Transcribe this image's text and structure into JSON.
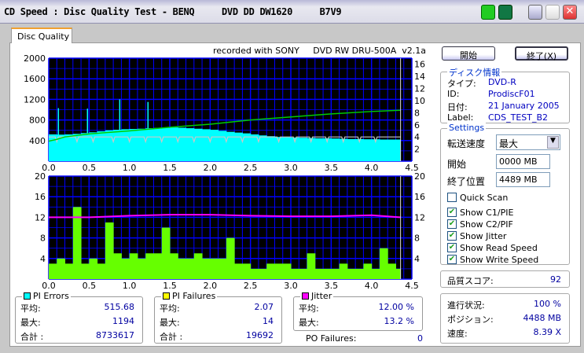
{
  "window": {
    "title": "CD Speed : Disc Quality Test - BENQ     DVD DD DW1620     B7V9"
  },
  "tabs": [
    {
      "label": "Disc Quality"
    }
  ],
  "chart_header": "recorded with SONY     DVD RW DRU-500A  v2.1a",
  "buttons": {
    "start": "開始",
    "stop": "終了(X)"
  },
  "disc_info": {
    "caption": "ディスク情報",
    "rows": [
      {
        "k": "タイプ:",
        "v": "DVD-R"
      },
      {
        "k": "ID:",
        "v": "ProdiscF01"
      },
      {
        "k": "日付:",
        "v": "21 January 2005"
      },
      {
        "k": "Label:",
        "v": "CDS_TEST_B2"
      }
    ]
  },
  "settings": {
    "caption": "Settings",
    "speed_label": "転送速度",
    "speed_value": "最大",
    "start_label": "開始",
    "start_value": "0000 MB",
    "end_label": "終了位置",
    "end_value": "4489 MB",
    "checks": [
      {
        "label": "Quick Scan",
        "checked": false
      },
      {
        "label": "Show C1/PIE",
        "checked": true
      },
      {
        "label": "Show C2/PIF",
        "checked": true
      },
      {
        "label": "Show Jitter",
        "checked": true
      },
      {
        "label": "Show Read Speed",
        "checked": true
      },
      {
        "label": "Show Write Speed",
        "checked": true
      }
    ]
  },
  "quality": {
    "label": "品質スコア:",
    "value": "92"
  },
  "progress": {
    "rows": [
      {
        "k": "進行状況:",
        "v": "100 %"
      },
      {
        "k": "ポジション:",
        "v": "4488 MB"
      },
      {
        "k": "速度:",
        "v": "8.39 X"
      }
    ]
  },
  "stats": {
    "pie": {
      "title": "PI Errors",
      "color": "#00ffff",
      "rows": [
        {
          "k": "平均:",
          "v": "515.68"
        },
        {
          "k": "最大:",
          "v": "1194"
        },
        {
          "k": "合計 :",
          "v": "8733617"
        }
      ]
    },
    "pif": {
      "title": "PI Failures",
      "color": "#ffff00",
      "rows": [
        {
          "k": "平均:",
          "v": "2.07"
        },
        {
          "k": "最大:",
          "v": "14"
        },
        {
          "k": "合計 :",
          "v": "19692"
        }
      ]
    },
    "jitter": {
      "title": "Jitter",
      "color": "#ff00ff",
      "rows": [
        {
          "k": "平均:",
          "v": "12.00 %"
        },
        {
          "k": "最大:",
          "v": "13.2 %"
        }
      ]
    },
    "po": {
      "k": "PO Failures:",
      "v": "0"
    }
  },
  "colors": {
    "plot_bg": "#000000",
    "grid": "#0000ff",
    "pie": "#00ffff",
    "pif": "#66ff00",
    "jitter": "#ff00ff",
    "read": "#00cc00",
    "write": "#c8c8c8"
  },
  "chart_data": [
    {
      "type": "bar",
      "xlim": [
        0,
        4.5
      ],
      "ylim_left": [
        0,
        2000
      ],
      "ylim_right": [
        0,
        17
      ],
      "xticks": [
        "0.0",
        "0.5",
        "1.0",
        "1.5",
        "2.0",
        "2.5",
        "3.0",
        "3.5",
        "4.0",
        "4.5"
      ],
      "yticks_left": [
        "2000",
        "1600",
        "1200",
        "800",
        "400"
      ],
      "yticks_right": [
        "16",
        "14",
        "12",
        "10",
        "8",
        "6",
        "4",
        "2"
      ],
      "pie": {
        "x": [
          0,
          0.1,
          0.2,
          0.3,
          0.4,
          0.5,
          0.6,
          0.7,
          0.8,
          0.9,
          1.0,
          1.1,
          1.2,
          1.3,
          1.4,
          1.5,
          1.6,
          1.7,
          1.8,
          1.9,
          2.0,
          2.1,
          2.2,
          2.3,
          2.4,
          2.5,
          2.6,
          2.7,
          2.8,
          2.9,
          3.0,
          3.1,
          3.2,
          3.3,
          3.4,
          3.5,
          3.6,
          3.7,
          3.8,
          3.9,
          4.0,
          4.1,
          4.2,
          4.3
        ],
        "y": [
          520,
          515,
          520,
          530,
          545,
          560,
          580,
          600,
          610,
          620,
          625,
          630,
          640,
          645,
          650,
          655,
          650,
          640,
          630,
          620,
          610,
          590,
          570,
          555,
          540,
          520,
          500,
          485,
          470,
          465,
          460,
          455,
          450,
          445,
          445,
          440,
          435,
          430,
          430,
          425,
          425,
          420,
          420,
          420
        ]
      },
      "pie_spikes": [
        {
          "x": 0.12,
          "y": 1030
        },
        {
          "x": 0.88,
          "y": 1200
        },
        {
          "x": 0.48,
          "y": 1020
        },
        {
          "x": 1.23,
          "y": 1150
        }
      ],
      "read_speed": {
        "x": [
          0,
          0.1,
          0.2,
          0.5,
          1.0,
          1.5,
          2.0,
          2.5,
          3.0,
          3.5,
          4.0,
          4.36
        ],
        "y": [
          3.3,
          3.6,
          4.0,
          4.5,
          5.0,
          5.6,
          6.1,
          6.8,
          7.3,
          7.8,
          8.2,
          8.4
        ]
      },
      "write_speed": {
        "level": 4,
        "dips_x": [
          0.1,
          0.35,
          0.55,
          0.8,
          1.0,
          1.2,
          1.4,
          1.6,
          1.8,
          2.0,
          2.2,
          2.4,
          2.6,
          2.85,
          3.05,
          3.25,
          3.45,
          3.65,
          3.85,
          4.05
        ]
      },
      "data_end": 4.36
    },
    {
      "type": "bar",
      "xlim": [
        0,
        4.5
      ],
      "ylim": [
        0,
        20
      ],
      "xticks": [
        "0.0",
        "0.5",
        "1.0",
        "1.5",
        "2.0",
        "2.5",
        "3.0",
        "3.5",
        "4.0",
        "4.5"
      ],
      "yticks": [
        "20",
        "16",
        "12",
        "8",
        "4"
      ],
      "pif": {
        "x": [
          0,
          0.1,
          0.2,
          0.3,
          0.4,
          0.5,
          0.6,
          0.7,
          0.8,
          0.9,
          1.0,
          1.1,
          1.2,
          1.3,
          1.4,
          1.5,
          1.6,
          1.7,
          1.8,
          1.9,
          2.0,
          2.1,
          2.2,
          2.3,
          2.4,
          2.5,
          2.6,
          2.7,
          2.8,
          2.9,
          3.0,
          3.1,
          3.2,
          3.3,
          3.4,
          3.5,
          3.6,
          3.7,
          3.8,
          3.9,
          4.0,
          4.1,
          4.2,
          4.3
        ],
        "y": [
          3,
          4,
          3,
          14,
          3,
          4,
          3,
          11,
          5,
          4,
          5,
          4,
          5,
          5,
          10,
          5,
          4,
          4,
          5,
          4,
          4,
          4,
          8,
          3,
          3,
          2,
          2,
          3,
          3,
          3,
          2,
          2,
          5,
          2,
          2,
          2,
          3,
          2,
          2,
          3,
          2,
          6,
          3,
          2
        ]
      },
      "jitter": {
        "x": [
          0,
          0.5,
          1.0,
          1.5,
          2.0,
          2.5,
          3.0,
          3.5,
          4.0,
          4.36
        ],
        "y": [
          12.0,
          12.0,
          12.3,
          12.5,
          12.5,
          12.3,
          12.2,
          12.2,
          12.4,
          12.0
        ]
      },
      "data_end": 4.36
    }
  ]
}
